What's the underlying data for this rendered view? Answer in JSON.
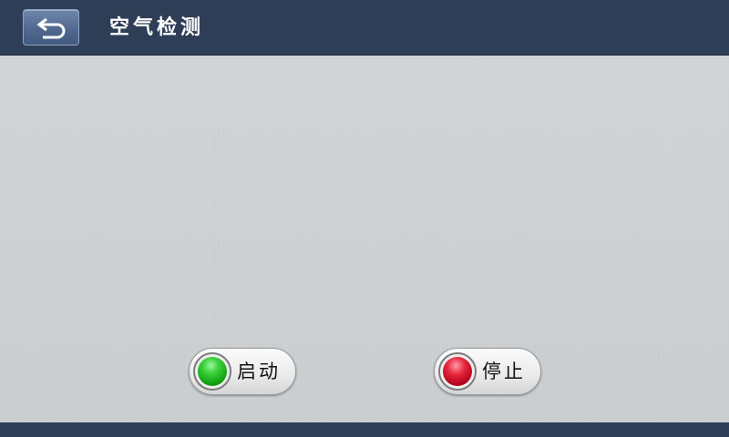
{
  "header": {
    "title": "空气检测",
    "back_icon": "return-arrow-icon"
  },
  "controls": {
    "start": {
      "label": "启动",
      "indicator_color": "#22c022",
      "icon": "green-led-icon"
    },
    "stop": {
      "label": "停止",
      "indicator_color": "#d0102a",
      "icon": "red-led-icon"
    }
  },
  "colors": {
    "header_bg": "#2f3e57",
    "body_bg": "#cdd1d4"
  }
}
